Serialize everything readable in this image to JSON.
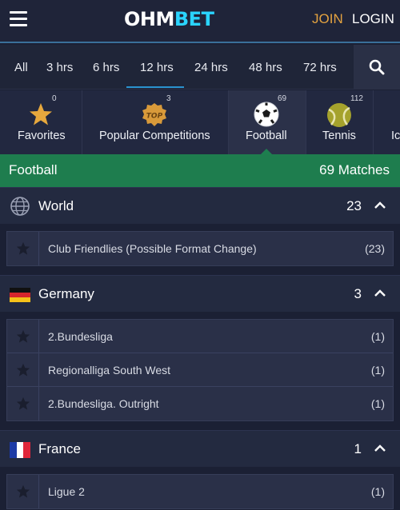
{
  "header": {
    "logo_part1": "OHM",
    "logo_part2": "BET",
    "join_label": "JOIN",
    "login_label": "LOGIN"
  },
  "time_filters": [
    {
      "label": "All"
    },
    {
      "label": "3 hrs"
    },
    {
      "label": "6 hrs"
    },
    {
      "label": "12 hrs",
      "active": true
    },
    {
      "label": "24 hrs"
    },
    {
      "label": "48 hrs"
    },
    {
      "label": "72 hrs"
    }
  ],
  "sports": [
    {
      "label": "Favorites",
      "count": "0",
      "icon": "star-icon"
    },
    {
      "label": "Popular Competitions",
      "count": "3",
      "icon": "top-badge-icon"
    },
    {
      "label": "Football",
      "count": "69",
      "icon": "football-icon",
      "active": true
    },
    {
      "label": "Tennis",
      "count": "112",
      "icon": "tennis-ball-icon"
    },
    {
      "label": "Ic",
      "icon": "ice-hockey-icon"
    }
  ],
  "section": {
    "title": "Football",
    "matches": "69 Matches"
  },
  "countries": [
    {
      "name": "World",
      "count": "23",
      "icon": "globe-icon",
      "leagues": [
        {
          "name": "Club Friendlies (Possible Format Change)",
          "count": "(23)"
        }
      ]
    },
    {
      "name": "Germany",
      "count": "3",
      "icon": "germany-flag-icon",
      "leagues": [
        {
          "name": "2.Bundesliga",
          "count": "(1)"
        },
        {
          "name": "Regionalliga South West",
          "count": "(1)"
        },
        {
          "name": "2.Bundesliga. Outright",
          "count": "(1)"
        }
      ]
    },
    {
      "name": "France",
      "count": "1",
      "icon": "france-flag-icon",
      "leagues": [
        {
          "name": "Ligue 2",
          "count": "(1)"
        }
      ]
    }
  ],
  "colors": {
    "accent_join": "#e3a240",
    "logo_accent": "#2ad4ff",
    "section_green": "#1e7d4e",
    "active_underline": "#2a93cf"
  }
}
